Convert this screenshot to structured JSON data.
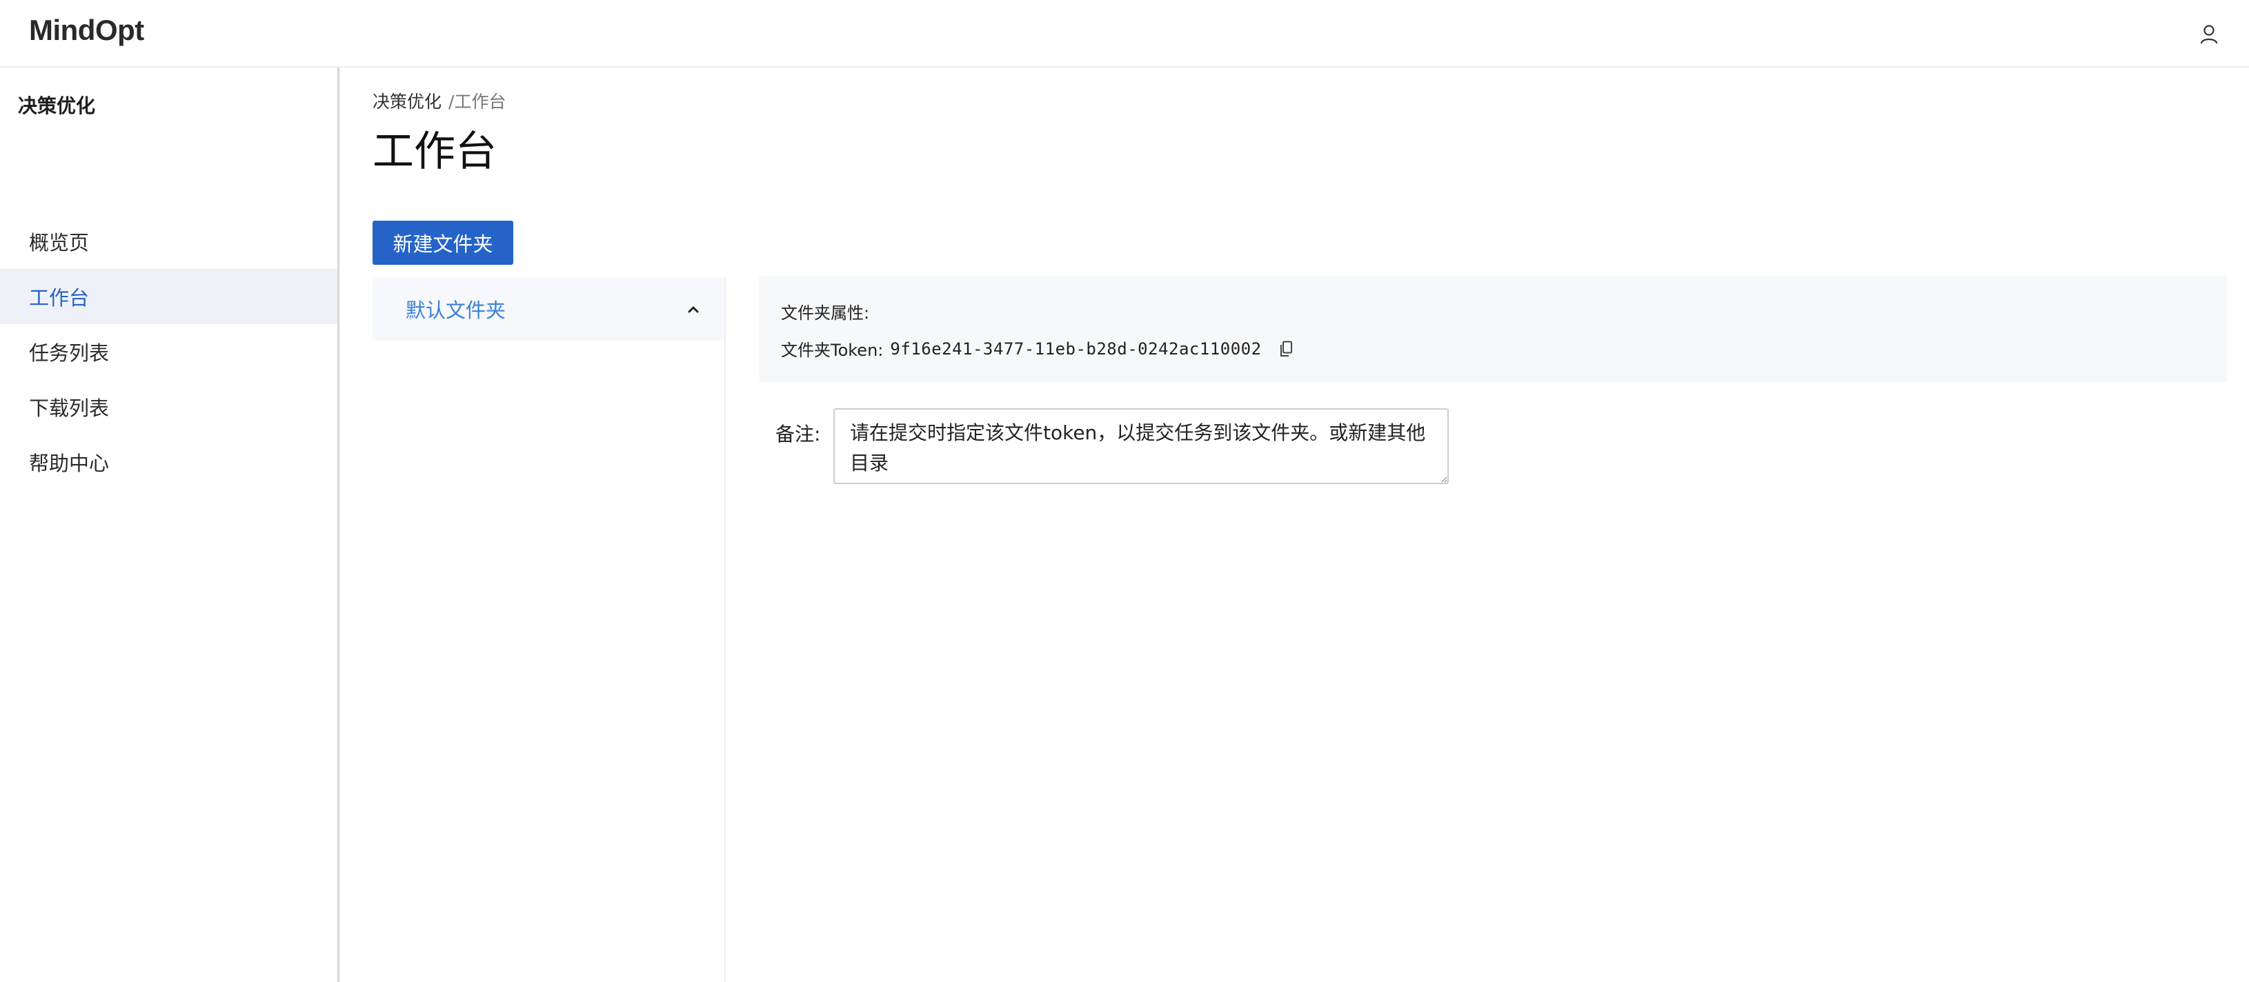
{
  "header": {
    "brand": "MindOpt",
    "user_icon": "user-icon"
  },
  "sidebar": {
    "title": "决策优化",
    "items": [
      {
        "label": "概览页",
        "active": false
      },
      {
        "label": "工作台",
        "active": true
      },
      {
        "label": "任务列表",
        "active": false
      },
      {
        "label": "下载列表",
        "active": false
      },
      {
        "label": "帮助中心",
        "active": false
      }
    ]
  },
  "breadcrumb": {
    "root": "决策优化",
    "separator": "/",
    "current": "工作台"
  },
  "page": {
    "title": "工作台",
    "new_folder_label": "新建文件夹"
  },
  "folders": {
    "items": [
      {
        "label": "默认文件夹",
        "expanded": true,
        "icon": "chevron-up-icon"
      }
    ]
  },
  "properties": {
    "title": "文件夹属性:",
    "token_label": "文件夹Token:",
    "token_value": "9f16e241-3477-11eb-b28d-0242ac110002",
    "copy_icon": "copy-icon"
  },
  "remark": {
    "label": "备注:",
    "value": "请在提交时指定该文件token，以提交任务到该文件夹。或新建其他目录"
  },
  "colors": {
    "accent": "#2563c9",
    "active_nav_bg": "#eef2f8",
    "active_nav_text": "#2a62c4",
    "folder_text": "#3b82d6",
    "props_bg": "#f7f8fa"
  }
}
